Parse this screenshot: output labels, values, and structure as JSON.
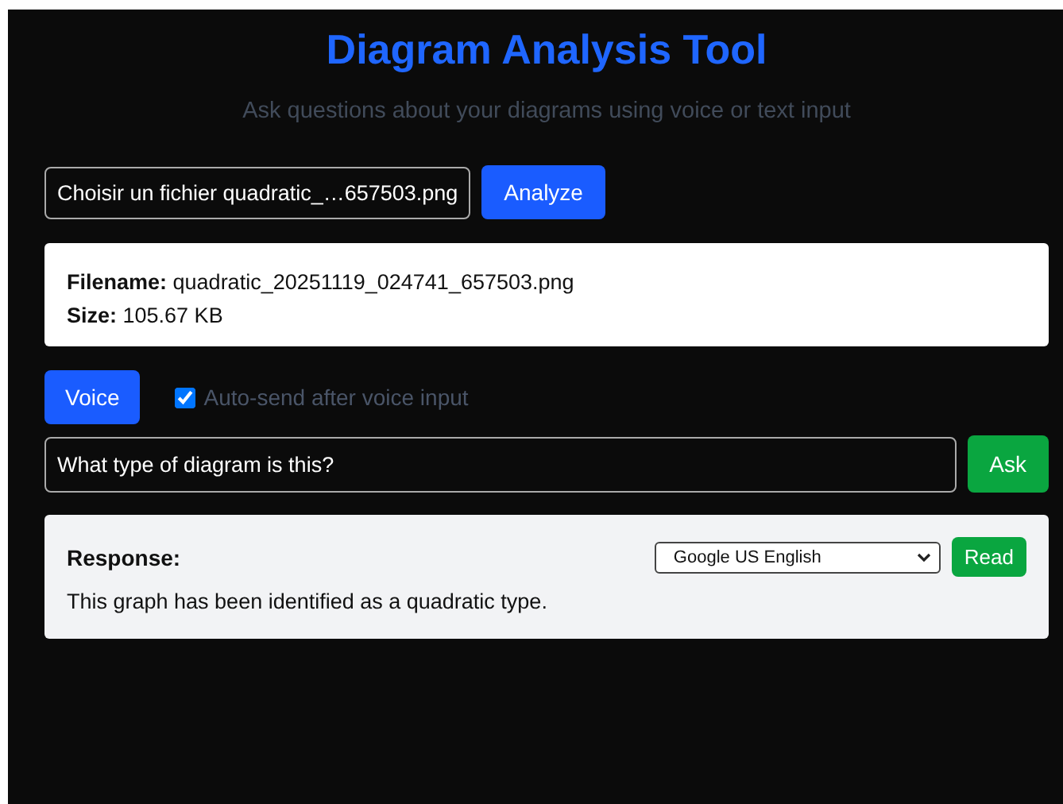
{
  "title": "Diagram Analysis Tool",
  "subtitle": "Ask questions about your diagrams using voice or text input",
  "file_picker": {
    "value": "Choisir un fichier quadratic_…657503.png"
  },
  "analyze_button": "Analyze",
  "file_info": [
    "**Filename:** quadratic_20251119_024741_657503.png",
    "**Size:** 105.67 KB"
  ],
  "voice_button": "Voice",
  "auto_send": {
    "label": "Auto-send after voice input",
    "checked": true
  },
  "question": {
    "value": "What type of diagram is this?"
  },
  "ask_button": "Ask",
  "response": {
    "heading": "Response:",
    "voice": "Google US English",
    "read_button": "Read",
    "text": "This graph has been identified as a quadratic type."
  }
}
